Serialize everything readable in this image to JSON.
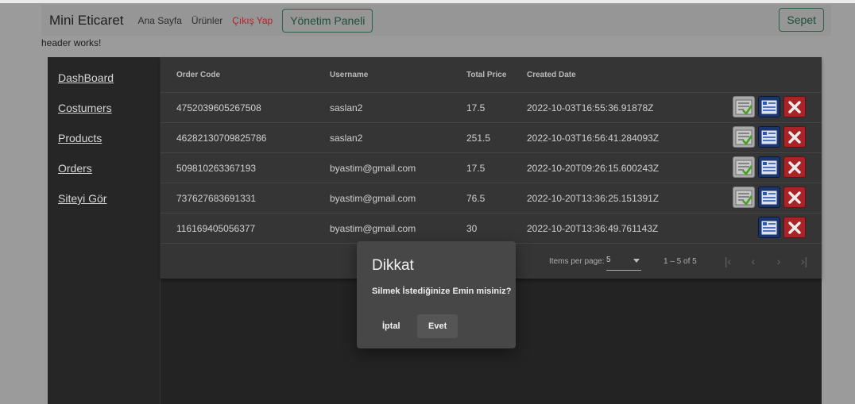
{
  "navbar": {
    "brand": "Mini Eticaret",
    "links": [
      "Ana Sayfa",
      "Ürünler",
      "Çıkış Yap"
    ],
    "panel_button": "Yönetim Paneli",
    "cart_button": "Sepet"
  },
  "header_text": "header works!",
  "sidebar": {
    "items": [
      "DashBoard",
      "Costumers",
      "Products",
      "Orders",
      "Siteyi Gör"
    ]
  },
  "table": {
    "headers": [
      "Order Code",
      "Username",
      "Total Price",
      "Created Date"
    ],
    "rows": [
      {
        "code": "4752039605267508",
        "user": "saslan2",
        "price": "17.5",
        "date": "2022-10-03T16:55:36.91878Z",
        "approved": false
      },
      {
        "code": "46282130709825786",
        "user": "saslan2",
        "price": "251.5",
        "date": "2022-10-03T16:56:41.284093Z",
        "approved": false
      },
      {
        "code": "509810263367193",
        "user": "byastim@gmail.com",
        "price": "17.5",
        "date": "2022-10-20T09:26:15.600243Z",
        "approved": false
      },
      {
        "code": "737627683691331",
        "user": "byastim@gmail.com",
        "price": "76.5",
        "date": "2022-10-20T13:36:25.151391Z",
        "approved": false
      },
      {
        "code": "116169405056377",
        "user": "byastim@gmail.com",
        "price": "30",
        "date": "2022-10-20T13:36:49.761143Z",
        "approved": true
      }
    ]
  },
  "paginator": {
    "label": "Items per page:",
    "page_size": "5",
    "range": "1 – 5 of 5"
  },
  "dialog": {
    "title": "Dikkat",
    "message": "Silmek İstediğinize Emin misiniz?",
    "cancel": "İptal",
    "confirm": "Evet"
  },
  "icons": {
    "approve": "approve-list-icon",
    "detail": "detail-list-icon",
    "delete": "delete-x-icon"
  },
  "colors": {
    "logout": "#c0282d",
    "outline_button": "#2f6b4f",
    "delete": "#b9262b",
    "detail": "#1e3b78"
  }
}
